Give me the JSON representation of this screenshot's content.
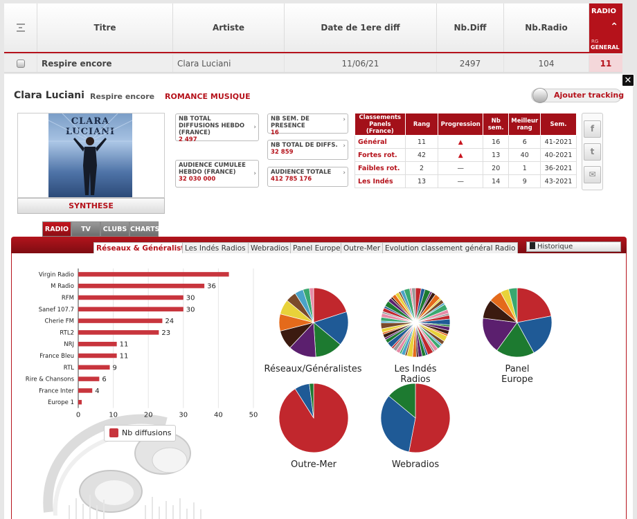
{
  "table": {
    "headers": [
      "Titre",
      "Artiste",
      "Date de 1ere diff",
      "Nb.Diff",
      "Nb.Radio"
    ],
    "radio_col": {
      "title": "RADIO",
      "sub1": "RG",
      "sub2": "GENERAL"
    },
    "row": {
      "titre": "Respire encore",
      "artiste": "Clara Luciani",
      "date": "11/06/21",
      "nb_diff": "2497",
      "nb_radio": "104",
      "rank": "11"
    }
  },
  "detail": {
    "artist": "Clara Luciani",
    "title": "Respire encore",
    "label": "ROMANCE MUSIQUE",
    "tracking_label": "Ajouter tracking",
    "cover_text": "CLARA LUCIANI",
    "synthese_label": "SYNTHESE",
    "stats": [
      {
        "key": "NB TOTAL DIFFUSIONS HEBDO (FRANCE)",
        "value": "2 497"
      },
      {
        "key": "AUDIENCE CUMULEE HEBDO (FRANCE)",
        "value": "32 030 000"
      },
      {
        "key": "NB SEM. DE PRESENCE",
        "value": "16"
      },
      {
        "key": "NB TOTAL DE DIFFS.",
        "value": "32 859"
      },
      {
        "key": "AUDIENCE TOTALE",
        "value": "412 785 176"
      }
    ],
    "classement": {
      "headers": [
        "Classements Panels (France)",
        "Rang",
        "Progression",
        "Nb sem.",
        "Meilleur rang",
        "Sem."
      ],
      "rows": [
        {
          "label": "Général",
          "rang": "11",
          "prog": "up",
          "nbsem": "16",
          "best": "6",
          "sem": "41-2021"
        },
        {
          "label": "Fortes rot.",
          "rang": "42",
          "prog": "up",
          "nbsem": "13",
          "best": "40",
          "sem": "40-2021"
        },
        {
          "label": "Faibles rot.",
          "rang": "2",
          "prog": "eq",
          "nbsem": "20",
          "best": "1",
          "sem": "36-2021"
        },
        {
          "label": "Les Indés",
          "rang": "13",
          "prog": "eq",
          "nbsem": "14",
          "best": "9",
          "sem": "43-2021"
        }
      ]
    },
    "social": [
      "f",
      "t",
      "mail"
    ]
  },
  "tabs": {
    "main": [
      "RADIO",
      "TV",
      "CLUBS",
      "CHARTS"
    ],
    "sub": [
      "Réseaux & Généralistes",
      "Les Indés Radios",
      "Webradios",
      "Panel Europe",
      "Outre-Mer",
      "Evolution classement général Radio"
    ],
    "historique": "Historique"
  },
  "chart_data": [
    {
      "type": "bar",
      "orientation": "horizontal",
      "categories": [
        "Virgin Radio",
        "M Radio",
        "RFM",
        "Sanef 107.7",
        "Cherie FM",
        "RTL2",
        "NRJ",
        "France Bleu",
        "RTL",
        "Rire & Chansons",
        "France Inter",
        "Europe 1"
      ],
      "series": [
        {
          "name": "Nb diffusions",
          "values": [
            43,
            36,
            30,
            30,
            24,
            23,
            11,
            11,
            9,
            6,
            4,
            1
          ]
        }
      ],
      "data_labels": [
        "",
        "36",
        "30",
        "30",
        "24",
        "23",
        "11",
        "11",
        "9",
        "6",
        "4",
        ""
      ],
      "xticks": [
        "0",
        "10",
        "20",
        "30",
        "40",
        "50"
      ],
      "xlim": [
        0,
        50
      ],
      "color": "#c8353d",
      "legend": "bottom"
    },
    {
      "type": "pie",
      "title": "Réseaux/Généralistes",
      "values": [
        20,
        16,
        13,
        13,
        9,
        8,
        7,
        5,
        4,
        3,
        2
      ],
      "colors": [
        "#c1272d",
        "#1f5a96",
        "#1d7a30",
        "#5b1f6e",
        "#3b1a10",
        "#e46a1b",
        "#e8d23a",
        "#7a4a2b",
        "#4aa3c8",
        "#3aa86f",
        "#e68aa6"
      ]
    },
    {
      "type": "pie",
      "title": "Les Indés Radios",
      "values": [
        3,
        2,
        3,
        1,
        2,
        3,
        1,
        2,
        1,
        3,
        2,
        1,
        2,
        3,
        1,
        2,
        2,
        1,
        3,
        2,
        1,
        2,
        2,
        1,
        3,
        1,
        2,
        2,
        1,
        2,
        3,
        1,
        2,
        1,
        2,
        2,
        1,
        3,
        2,
        1,
        2,
        1,
        2,
        3,
        1,
        2,
        2,
        1,
        2,
        1,
        3,
        2,
        1,
        2,
        2,
        1,
        2,
        3,
        1,
        2
      ],
      "colors": [
        "#c1272d",
        "#1f5a96",
        "#1d7a30",
        "#5b1f6e",
        "#3b1a10",
        "#e46a1b",
        "#e8d23a",
        "#7a4a2b",
        "#4aa3c8",
        "#3aa86f",
        "#e68aa6",
        "#999999"
      ]
    },
    {
      "type": "pie",
      "title": "Panel Europe",
      "values": [
        22,
        20,
        18,
        17,
        9,
        6,
        4,
        4
      ],
      "colors": [
        "#c1272d",
        "#1f5a96",
        "#1d7a30",
        "#5b1f6e",
        "#3b1a10",
        "#e46a1b",
        "#e8d23a",
        "#3aa86f"
      ]
    },
    {
      "type": "pie",
      "title": "Outre-Mer",
      "values": [
        91,
        7,
        2
      ],
      "colors": [
        "#c1272d",
        "#1f5a96",
        "#1d7a30"
      ]
    },
    {
      "type": "pie",
      "title": "Webradios",
      "values": [
        53,
        33,
        14
      ],
      "colors": [
        "#c1272d",
        "#1f5a96",
        "#1d7a30"
      ]
    }
  ]
}
